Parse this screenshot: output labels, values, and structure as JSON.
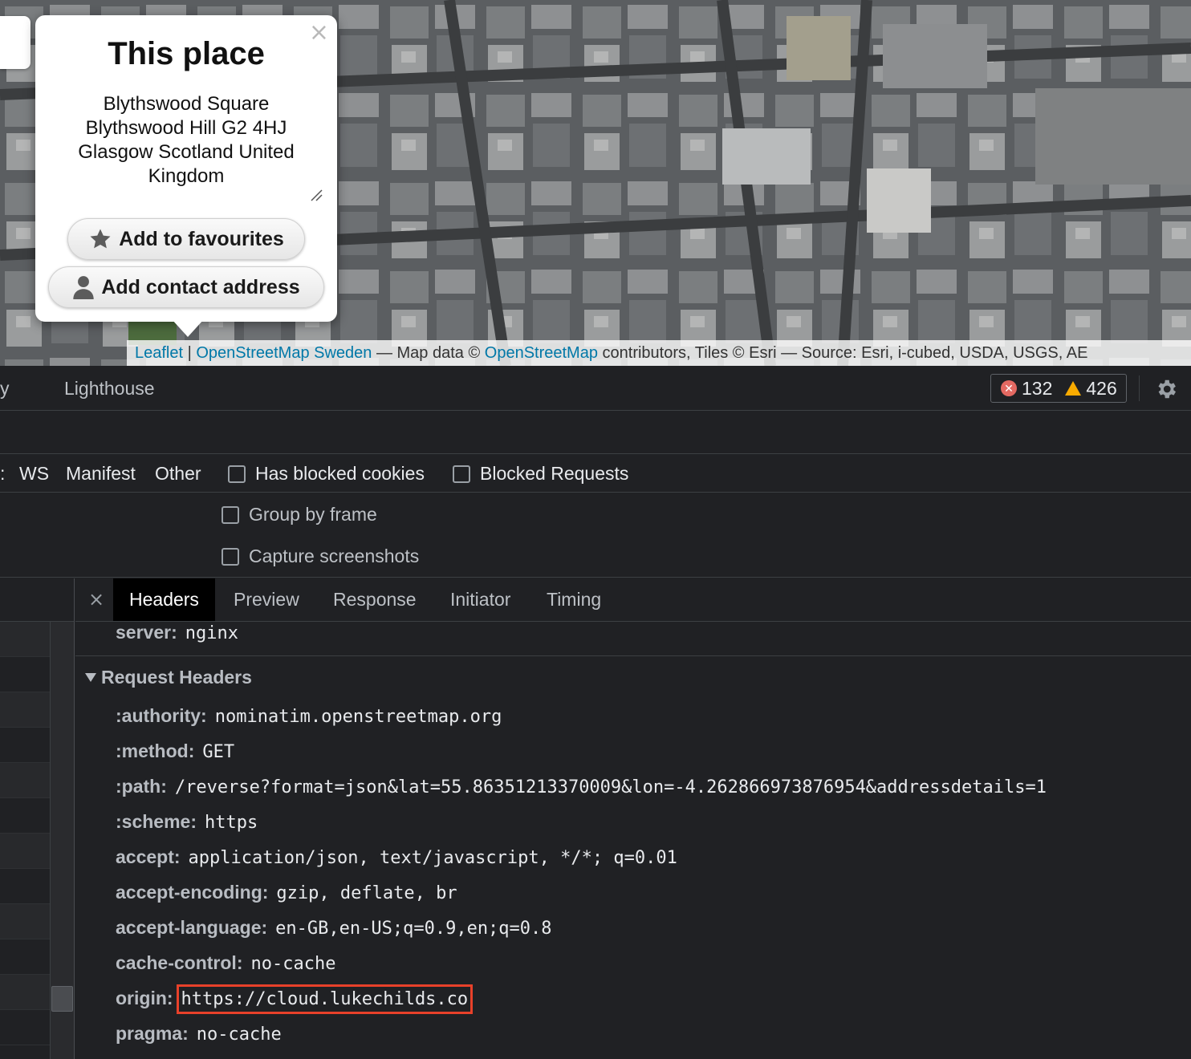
{
  "map": {
    "popup": {
      "title": "This place",
      "address": "Blythswood Square\nBlythswood Hill G2 4HJ\nGlasgow Scotland United\nKingdom",
      "close_label": "×",
      "favourites_label": "Add to favourites",
      "contact_label": "Add contact address"
    },
    "attribution": {
      "leaflet": "Leaflet",
      "sep1": " | ",
      "osm_sweden": "OpenStreetMap Sweden",
      "text1": " — Map data © ",
      "osm": "OpenStreetMap",
      "text2": " contributors, Tiles © Esri — Source: Esri, i-cubed, USDA, USGS, AE"
    }
  },
  "devtools": {
    "tabs": {
      "cut_tab": "y",
      "lighthouse": "Lighthouse"
    },
    "issues": {
      "errors": "132",
      "warnings": "426"
    },
    "filters": {
      "cut_item": ":",
      "ws": "WS",
      "manifest": "Manifest",
      "other": "Other",
      "has_blocked_cookies": "Has blocked cookies",
      "blocked_requests": "Blocked Requests"
    },
    "settings": {
      "group_by_frame": "Group by frame",
      "capture_screenshots": "Capture screenshots"
    },
    "detail_tabs": {
      "close": "×",
      "headers": "Headers",
      "preview": "Preview",
      "response": "Response",
      "initiator": "Initiator",
      "timing": "Timing"
    },
    "response_tail": {
      "key": "server:",
      "value": "nginx"
    },
    "request_headers_title": "Request Headers",
    "request_headers": [
      {
        "key": ":authority:",
        "value": "nominatim.openstreetmap.org"
      },
      {
        "key": ":method:",
        "value": "GET"
      },
      {
        "key": ":path:",
        "value": "/reverse?format=json&lat=55.86351213370009&lon=-4.262866973876954&addressdetails=1"
      },
      {
        "key": ":scheme:",
        "value": "https"
      },
      {
        "key": "accept:",
        "value": "application/json, text/javascript, */*; q=0.01"
      },
      {
        "key": "accept-encoding:",
        "value": "gzip, deflate, br"
      },
      {
        "key": "accept-language:",
        "value": "en-GB,en-US;q=0.9,en;q=0.8"
      },
      {
        "key": "cache-control:",
        "value": "no-cache"
      },
      {
        "key": "origin:",
        "value": "https://cloud.lukechilds.co"
      },
      {
        "key": "pragma:",
        "value": "no-cache"
      }
    ],
    "colors": {
      "highlight": "#e8412a",
      "link": "#0078a8",
      "error": "#e46962",
      "warning": "#f9ab00"
    }
  }
}
